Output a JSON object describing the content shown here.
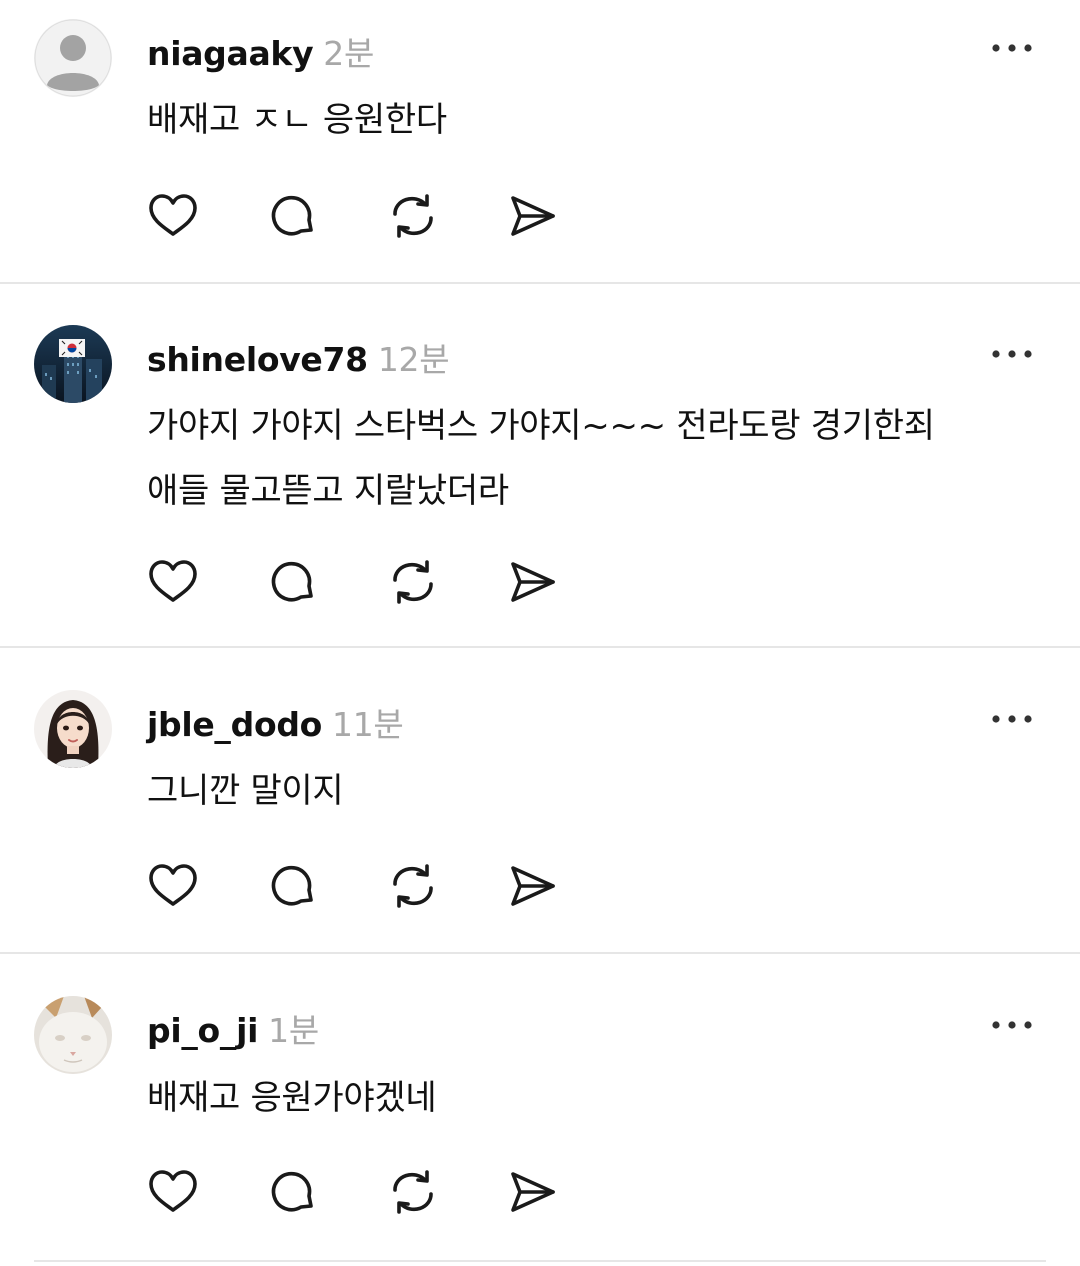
{
  "comments": [
    {
      "username": "niagaaky",
      "time": "2분",
      "lines": [
        "배재고 ㅈㄴ 응원한다"
      ],
      "avatar": "default-avatar"
    },
    {
      "username": "shinelove78",
      "time": "12분",
      "lines": [
        "가야지 가야지 스타벅스 가야지~~~ 전라도랑 경기한죄",
        "애들 물고뜯고 지랄났더라"
      ],
      "avatar": "korean-flag-building-photo"
    },
    {
      "username": "jble_dodo",
      "time": "11분",
      "lines": [
        "그니깐 말이지"
      ],
      "avatar": "illustrated-woman-portrait"
    },
    {
      "username": "pi_o_ji",
      "time": "1분",
      "lines": [
        "배재고 응원가야겠네"
      ],
      "avatar": "white-cat-photo"
    }
  ],
  "icons": {
    "more": "more-horizontal-icon",
    "like": "heart-icon",
    "reply": "comment-bubble-icon",
    "repost": "repost-icon",
    "share": "send-icon"
  },
  "colors": {
    "text": "#111111",
    "timestamp": "#a8a8a8",
    "divider": "#e6e6e6",
    "icon": "#1a1a1a"
  }
}
